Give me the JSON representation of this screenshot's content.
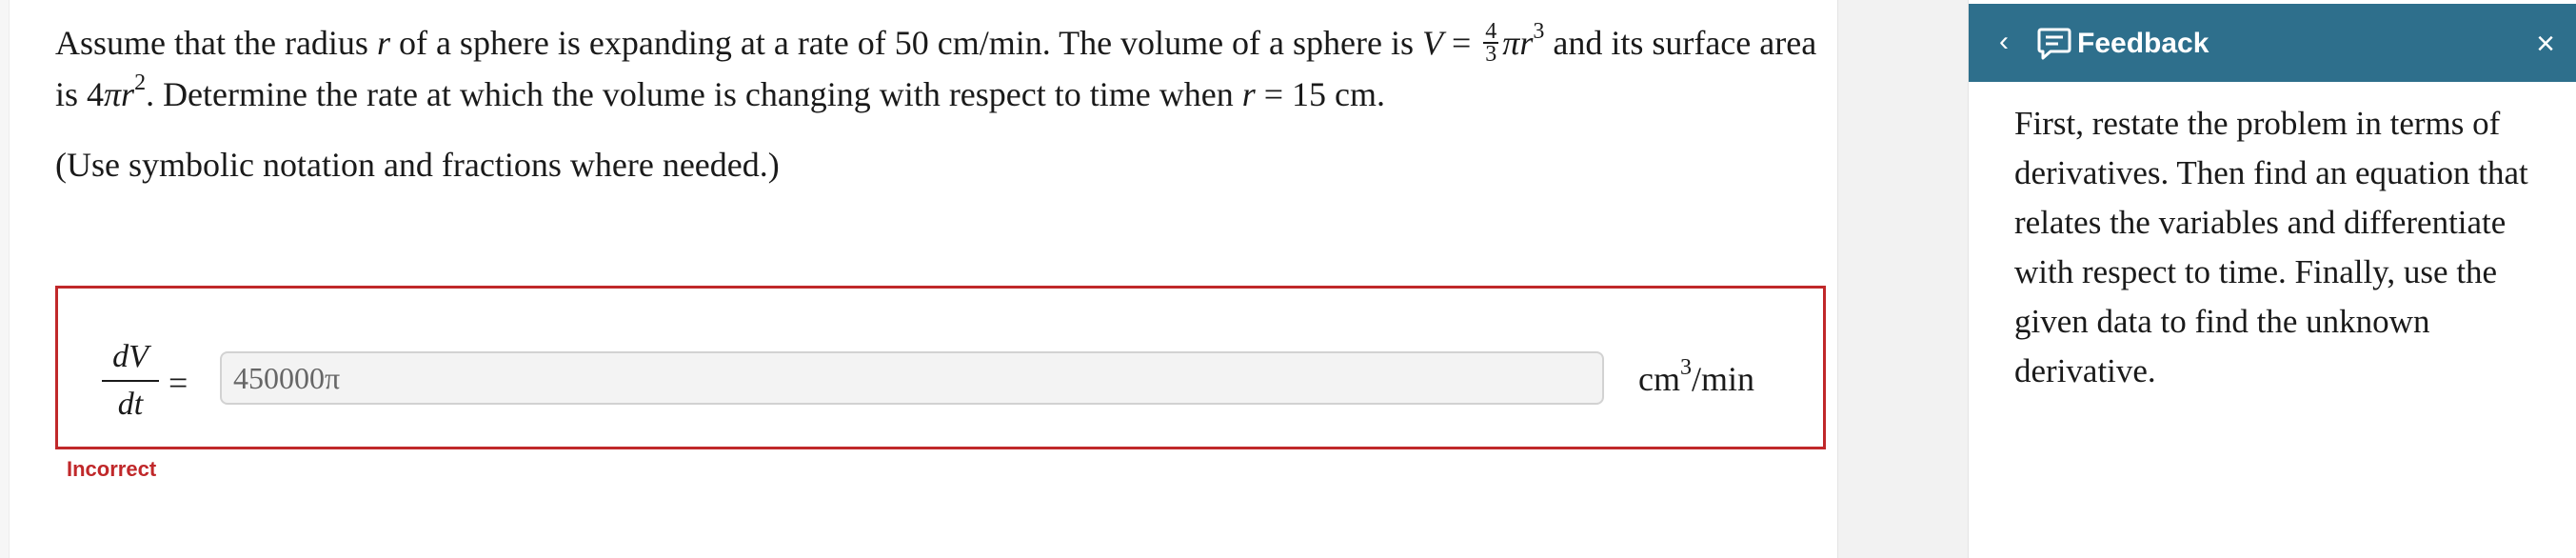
{
  "question": {
    "text_1": "Assume that the radius ",
    "var_r": "r",
    "text_2": " of a sphere is expanding at a rate of 50 cm/min. The volume of a sphere is ",
    "var_V": "V",
    "eq": " = ",
    "frac_num": "4",
    "frac_den": "3",
    "pi_r": "πr",
    "exp_3": "3",
    "text_3": " and its surface area is 4",
    "pi_r2": "πr",
    "exp_2": "2",
    "text_4": ". Determine the rate at which the volume is changing with respect to time when ",
    "var_r2": "r",
    "text_5": " = 15 cm.",
    "note": "(Use symbolic notation and fractions where needed.)"
  },
  "answer": {
    "deriv_num": "dV",
    "deriv_den": "dt",
    "equals": "=",
    "value": "450000π",
    "units_base": "cm",
    "units_exp": "3",
    "units_tail": "/min",
    "status": "Incorrect"
  },
  "feedback": {
    "title": "Feedback",
    "back_icon": "‹",
    "close_icon": "×",
    "body": "First, restate the problem in terms of derivatives. Then find an equation that relates the variables and differentiate with respect to time. Finally, use the given data to find the unknown derivative."
  },
  "colors": {
    "header_bg": "#2e6f8c",
    "error_red": "#c0282a"
  }
}
